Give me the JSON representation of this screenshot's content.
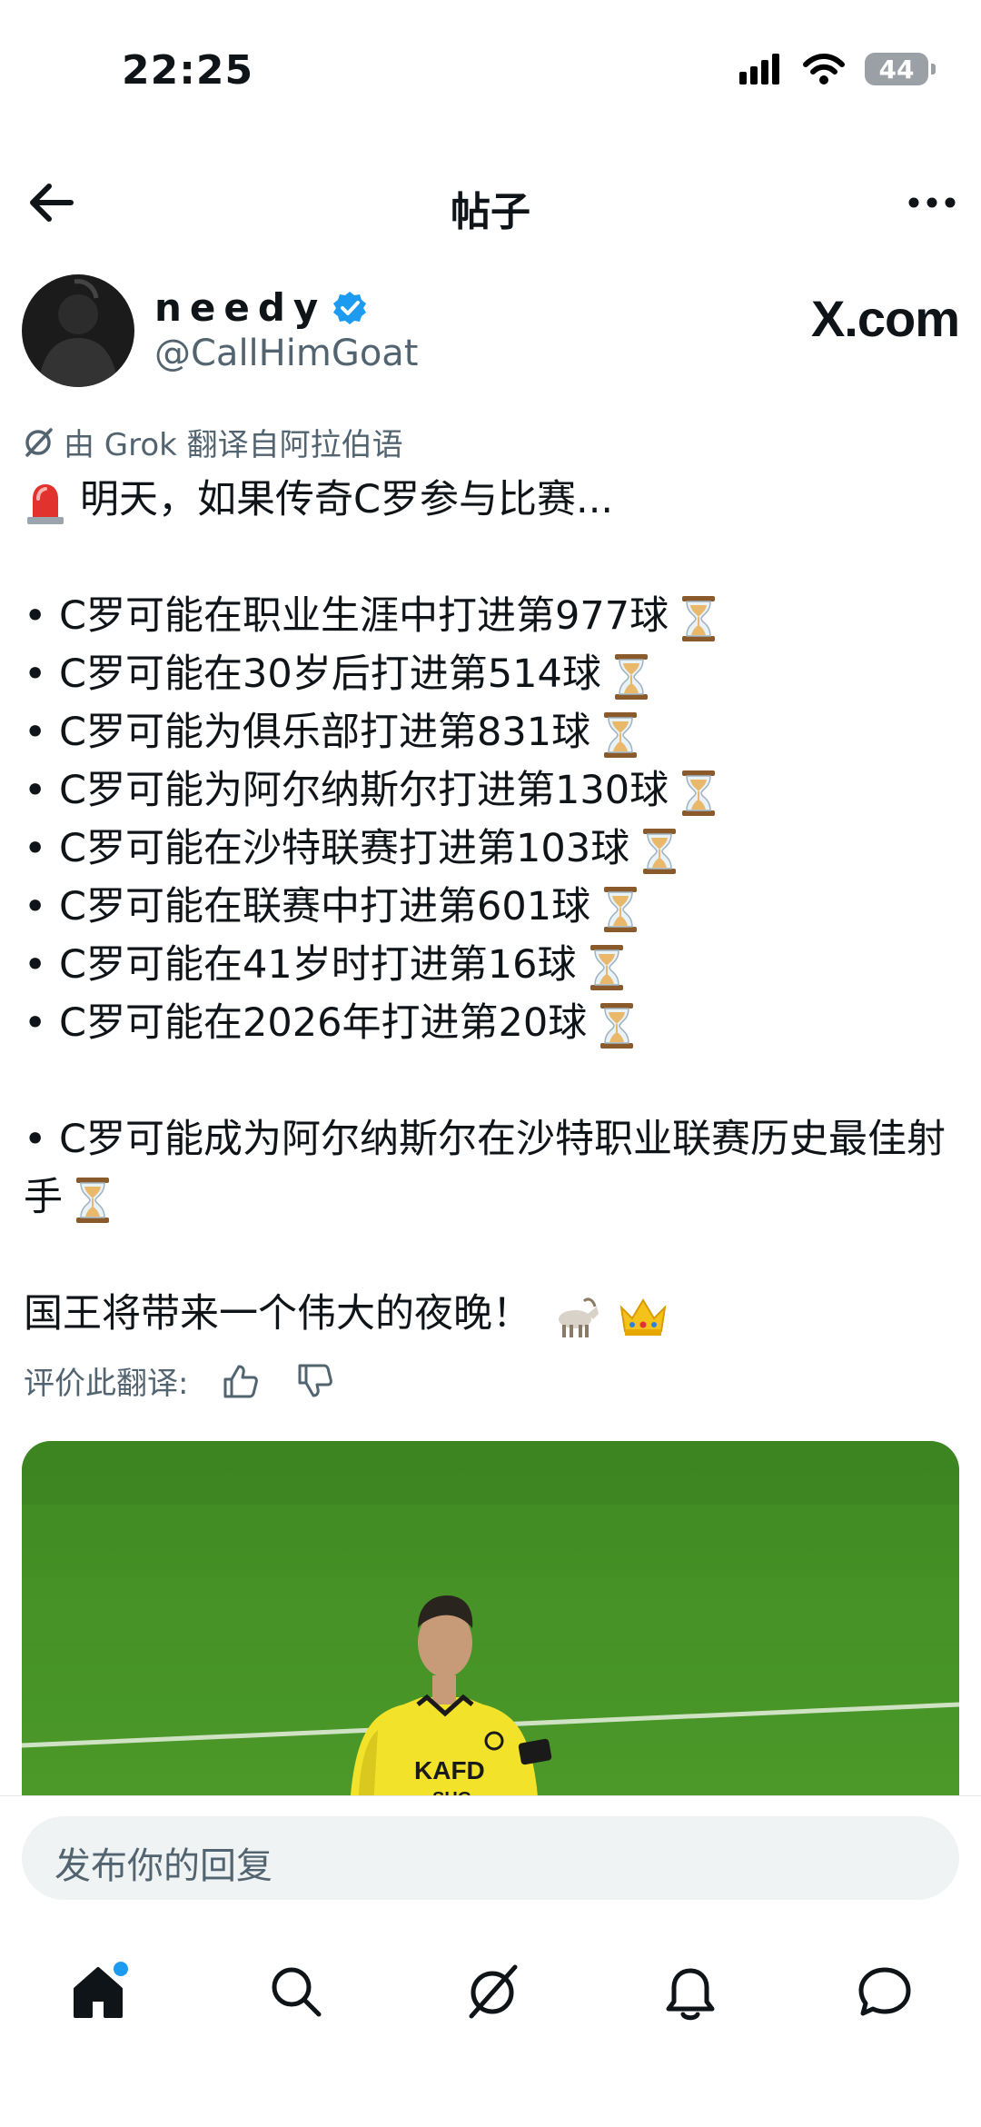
{
  "status": {
    "time": "22:25",
    "battery": "44"
  },
  "header": {
    "title": "帖子"
  },
  "author": {
    "name": "needy",
    "handle": "@CallHimGoat",
    "badge": "X.com"
  },
  "translation_note": "由 Grok 翻译自阿拉伯语",
  "post": {
    "intro": "明天，如果传奇C罗参与比赛...",
    "list": [
      "• C罗可能在职业生涯中打进第977球",
      "• C罗可能在30岁后打进第514球",
      "• C罗可能为俱乐部打进第831球",
      "• C罗可能为阿尔纳斯尔打进第130球",
      "• C罗可能在沙特联赛打进第103球",
      "• C罗可能在联赛中打进第601球",
      "• C罗可能在41岁时打进第16球",
      "• C罗可能在2026年打进第20球"
    ],
    "extra": "• C罗可能成为阿尔纳斯尔在沙特职业联赛历史最佳射手",
    "closing": "国王将带来一个伟大的夜晚！"
  },
  "rate_label": "评价此翻译:",
  "media": {
    "jersey_text": "KAFD",
    "sponsor_text": "SHG"
  },
  "reply": {
    "placeholder": "发布你的回复"
  },
  "colors": {
    "accent": "#1d9bf0",
    "secondary_text": "#536471",
    "pitch": "#3f8a22",
    "jersey": "#f2e22a"
  },
  "tabs": [
    "home-icon",
    "search-icon",
    "grok-icon",
    "notifications-icon",
    "messages-icon"
  ]
}
